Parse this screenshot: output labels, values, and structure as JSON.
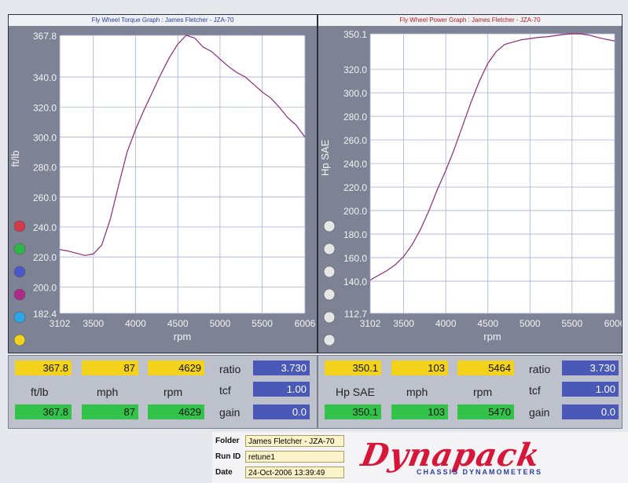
{
  "chart_data": [
    {
      "type": "line",
      "title": "Fly Wheel Torque Graph : James Fletcher - JZA-70",
      "xlabel": "rpm",
      "ylabel": "ft/lb",
      "xlim": [
        3102,
        6006
      ],
      "ylim": [
        182.4,
        367.8
      ],
      "xticks": [
        "3102",
        "3500",
        "4000",
        "4500",
        "5000",
        "5500",
        "6006"
      ],
      "yticks": [
        "367.8",
        "340.0",
        "320.0",
        "300.0",
        "280.0",
        "260.0",
        "240.0",
        "220.0",
        "200.0",
        "182.4"
      ],
      "series": [
        {
          "color": "#8a2a78",
          "x": [
            3102,
            3200,
            3300,
            3400,
            3500,
            3600,
            3700,
            3800,
            3900,
            4000,
            4100,
            4200,
            4300,
            4400,
            4500,
            4600,
            4700,
            4800,
            4900,
            5000,
            5100,
            5200,
            5300,
            5400,
            5500,
            5600,
            5700,
            5800,
            5900,
            6006
          ],
          "y": [
            225,
            224,
            222.5,
            221,
            222,
            228,
            245,
            268,
            290,
            305,
            318,
            330,
            342,
            353,
            362,
            367.8,
            366,
            360,
            357,
            352,
            347,
            343,
            340,
            335,
            330,
            326,
            320,
            313,
            308,
            300
          ]
        }
      ]
    },
    {
      "type": "line",
      "title": "Fly Wheel Power Graph : James Fletcher - JZA-70",
      "xlabel": "rpm",
      "ylabel": "Hp SAE",
      "xlim": [
        3102,
        6006
      ],
      "ylim": [
        112.7,
        350.1
      ],
      "xticks": [
        "3102",
        "3500",
        "4000",
        "4500",
        "5000",
        "5500",
        "6006"
      ],
      "yticks": [
        "350.1",
        "320.0",
        "300.0",
        "280.0",
        "260.0",
        "240.0",
        "220.0",
        "200.0",
        "180.0",
        "160.0",
        "140.0",
        "112.7"
      ],
      "series": [
        {
          "color": "#8a2a78",
          "x": [
            3102,
            3200,
            3300,
            3400,
            3500,
            3600,
            3700,
            3800,
            3900,
            4000,
            4100,
            4200,
            4300,
            4400,
            4500,
            4600,
            4700,
            4800,
            4900,
            5000,
            5100,
            5200,
            5300,
            5400,
            5500,
            5600,
            5700,
            5800,
            5900,
            6006
          ],
          "y": [
            141,
            145,
            149,
            154,
            161,
            171,
            184,
            200,
            218,
            234,
            252,
            272,
            292,
            310,
            325,
            335,
            341,
            343,
            345,
            346,
            347,
            347.5,
            348.5,
            349.5,
            350.1,
            350,
            349,
            347,
            345.5,
            344
          ]
        }
      ]
    }
  ],
  "torque_stats": {
    "top_values": [
      "367.8",
      "87",
      "4629"
    ],
    "labels": [
      "ft/lb",
      "mph",
      "rpm"
    ],
    "bottom_values": [
      "367.8",
      "87",
      "4629"
    ],
    "ratio_label": "ratio",
    "ratio_value": "3.730",
    "tcf_label": "tcf",
    "tcf_value": "1.00",
    "gain_label": "gain",
    "gain_value": "0.0"
  },
  "power_stats": {
    "top_values": [
      "350.1",
      "103",
      "5464"
    ],
    "labels": [
      "Hp SAE",
      "mph",
      "rpm"
    ],
    "bottom_values": [
      "350.1",
      "103",
      "5470"
    ],
    "ratio_label": "ratio",
    "ratio_value": "3.730",
    "tcf_label": "tcf",
    "tcf_value": "1.00",
    "gain_label": "gain",
    "gain_value": "0.0"
  },
  "legend_dot_colors": [
    "#d23a4a",
    "#2fb84a",
    "#4a59c8",
    "#b02a8a",
    "#2aa8e8",
    "#f3d21c"
  ],
  "footer": {
    "folder_label": "Folder",
    "folder_value": "James Fletcher - JZA-70",
    "runid_label": "Run ID",
    "runid_value": "retune1",
    "date_label": "Date",
    "date_value": "24-Oct-2006  13:39:49",
    "logo_text": "Dynapack",
    "logo_sub": "CHASSIS DYNAMOMETERS"
  }
}
